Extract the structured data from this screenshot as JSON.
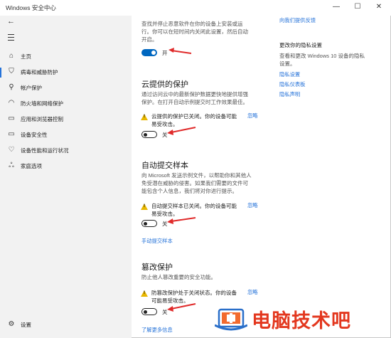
{
  "window": {
    "title": "Windows 安全中心",
    "min": "—",
    "max": "☐",
    "close": "✕"
  },
  "sidebar": {
    "items": [
      {
        "label": "主页",
        "icon": "home-icon"
      },
      {
        "label": "病毒和威胁防护",
        "icon": "shield-icon"
      },
      {
        "label": "帐户保护",
        "icon": "person-icon"
      },
      {
        "label": "防火墙和网络保护",
        "icon": "wifi-icon"
      },
      {
        "label": "应用和浏览器控制",
        "icon": "app-window-icon"
      },
      {
        "label": "设备安全性",
        "icon": "laptop-icon"
      },
      {
        "label": "设备性能和运行状况",
        "icon": "heart-icon"
      },
      {
        "label": "家庭选项",
        "icon": "family-icon"
      }
    ],
    "settings": "设置"
  },
  "realtime": {
    "desc1": "查找并停止恶意软件在你的设备上安装或运",
    "desc2": "行。你可以在短时间内关闭此设置，然后自动",
    "desc3": "开启。",
    "toggle_label": "开"
  },
  "cloud": {
    "title": "云提供的保护",
    "desc1": "通过访问云中的最新保护数据更快地提供增强",
    "desc2": "保护。在打开自动示例提交时工作效果最佳。",
    "warn1": "云提供的保护已关闭。你的设备可能",
    "warn2": "易受攻击。",
    "dismiss": "忽略",
    "toggle_label": "关"
  },
  "sample": {
    "title": "自动提交样本",
    "desc1": "向 Microsoft 发送示例文件，以帮助你和其他人",
    "desc2": "免受潜在威胁的侵害。如果我们需要的文件可",
    "desc3": "能包含个人信息，我们将对你进行提示。",
    "warn1": "自动提交样本已关闭。你的设备可能",
    "warn2": "易受攻击。",
    "dismiss": "忽略",
    "toggle_label": "关",
    "manual_link": "手动提交样本"
  },
  "tamper": {
    "title": "篡改保护",
    "desc1": "防止他人篡改重要的安全功能。",
    "warn1": "防篡改保护处于关闭状态。你的设备",
    "warn2": "可能易受攻击。",
    "dismiss": "忽略",
    "toggle_label": "关",
    "more_link": "了解更多信息"
  },
  "right": {
    "feedback_link": "向我们提供反馈",
    "privacy_title": "更改你的隐私设置",
    "privacy_desc1": "查看和更改 Windows 10 设备的隐私",
    "privacy_desc2": "设置。",
    "link1": "隐私设置",
    "link2": "隐私仪表板",
    "link3": "隐私声明"
  },
  "watermark": {
    "text": "电脑技术吧"
  }
}
